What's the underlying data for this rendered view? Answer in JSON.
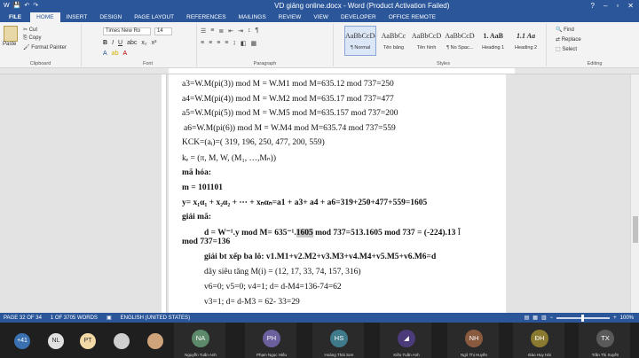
{
  "window": {
    "title": "VD giảng online.docx - Word (Product Activation Failed)",
    "controls": [
      "?",
      "–",
      "▫",
      "✕"
    ]
  },
  "ribbon_tabs": [
    "FILE",
    "HOME",
    "INSERT",
    "DESIGN",
    "PAGE LAYOUT",
    "REFERENCES",
    "MAILINGS",
    "REVIEW",
    "VIEW",
    "DEVELOPER",
    "OFFICE REMOTE"
  ],
  "active_tab": "HOME",
  "clipboard": {
    "paste": "Paste",
    "cut": "Cut",
    "copy": "Copy",
    "format_painter": "Format Painter",
    "label": "Clipboard"
  },
  "font": {
    "name": "Times New Ro",
    "size": "14",
    "label": "Font"
  },
  "paragraph": {
    "label": "Paragraph"
  },
  "styles": {
    "label": "Styles",
    "items": [
      {
        "sample": "AaBbCcDc",
        "name": "¶ Normal"
      },
      {
        "sample": "AaBbCc",
        "name": "Tên bảng"
      },
      {
        "sample": "AaBbCcD",
        "name": "Tên hình"
      },
      {
        "sample": "AaBbCcDc",
        "name": "¶ No Spac..."
      },
      {
        "sample": "1. AaB",
        "name": "Heading 1"
      },
      {
        "sample": "1.1 Aa",
        "name": "Heading 2"
      }
    ]
  },
  "editing": {
    "find": "Find",
    "replace": "Replace",
    "select": "Select",
    "label": "Editing"
  },
  "document": {
    "lines": [
      "a3=W.M(pi(3)) mod M = W.M1 mod M=635.12 mod 737=250",
      "a4=W.M(pi(4)) mod M = W.M2 mod M=635.17 mod 737=477",
      "a5=W.M(pi(5)) mod M = W.M5 mod M=635.157 mod 737=200",
      "a6=W.M(pi(6)) mod M = W.M4 mod M=635.74 mod 737=559",
      "KCK=(aᵢ)=( 319, 196, 250, 477, 200, 559)",
      "kₑ = (π, M, W, (M₁, …,Mₙ))",
      "mã hóa:",
      "m = 101101",
      "y= x₁α₁ + x₂α₂ + ⋯ + xₙαₙ=a1 + a3+ a4 + a6=319+250+477+559=1605",
      "giải mã:",
      "d = W⁻¹.y mod M= 635⁻¹.",
      "1605",
      " mod 737=513.1605 mod 737 = (-224).13",
      "mod 737=136",
      "giải bt xếp ba lô: v1.M1+v2.M2+v3.M3+v4.M4+v5.M5+v6.M6=d",
      "dãy siêu tăng M(i) = (12, 17, 33, 74, 157, 316)",
      "v6=0; v5=0; v4=1; d= d-M4=136-74=62",
      "v3=1; d= d-M3 = 62- 33=29"
    ]
  },
  "status": {
    "page": "PAGE 32 OF 34",
    "words": "1 OF 3705 WORDS",
    "language": "ENGLISH (UNITED STATES)",
    "zoom": "100%"
  },
  "participants": {
    "more_count": "+41",
    "tiles": [
      {
        "initials": "NL",
        "color": "#e0e0e0"
      },
      {
        "initials": "PT",
        "color": "#f3d9a6"
      },
      {
        "initials": "",
        "color": "#cfcfcf"
      },
      {
        "initials": "",
        "color": "#cfa47a"
      },
      {
        "initials": "NA",
        "color": "#5d8a6a",
        "name": "Nguyễn Tuấn Anh"
      },
      {
        "initials": "PH",
        "color": "#6b5f9e",
        "name": "Phạm Ngọc Hiếu"
      },
      {
        "initials": "HS",
        "color": "#3f7a8a",
        "name": "Hoàng Thái Sơn"
      },
      {
        "initials": "",
        "color": "#4b3b7a",
        "name": "Kiều Tuấn Anh"
      },
      {
        "initials": "NH",
        "color": "#8a5a3f",
        "name": "Ngô Thị Huyền"
      },
      {
        "initials": "ĐH",
        "color": "#8a7a2f",
        "name": "Đào Huy Hải"
      },
      {
        "initials": "TX",
        "color": "#5a5a5a",
        "name": "Trần Thị Xuyến"
      }
    ]
  }
}
